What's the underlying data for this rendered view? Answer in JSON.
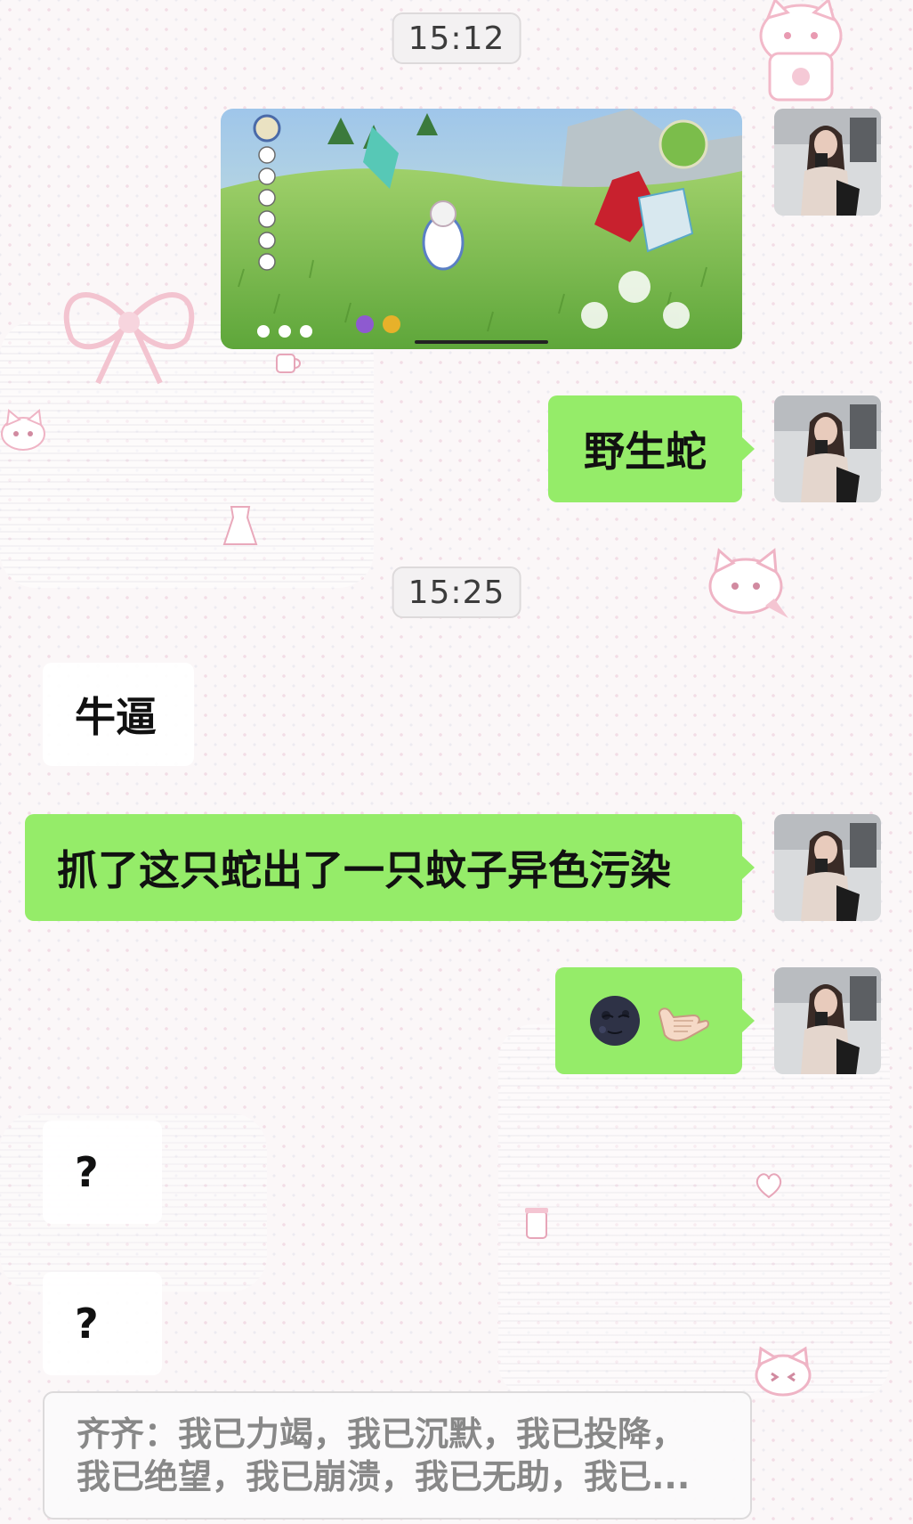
{
  "chat": {
    "timestamps": [
      "15:12",
      "15:25"
    ],
    "messages": [
      {
        "sender": "me",
        "type": "image",
        "alt": "game screenshot"
      },
      {
        "sender": "me",
        "type": "text",
        "text": "野生蛇"
      },
      {
        "sender": "other",
        "type": "text",
        "text": "牛逼"
      },
      {
        "sender": "me",
        "type": "text",
        "text": "抓了这只蛇出了一只蚊子异色污染"
      },
      {
        "sender": "me",
        "type": "emoji",
        "emojis": [
          "new-moon-face-icon",
          "call-me-hand-icon"
        ]
      },
      {
        "sender": "other",
        "type": "text",
        "text": "?"
      },
      {
        "sender": "other",
        "type": "text",
        "text": "?"
      }
    ]
  },
  "quote_preview": {
    "line1": "齐齐：我已力竭，我已沉默，我已投降，",
    "line2": "我已绝望，我已崩溃，我已无助，我已..."
  },
  "colors": {
    "my_bubble": "#95ec69",
    "other_bubble": "#ffffff",
    "background": "#fbf7f8"
  }
}
